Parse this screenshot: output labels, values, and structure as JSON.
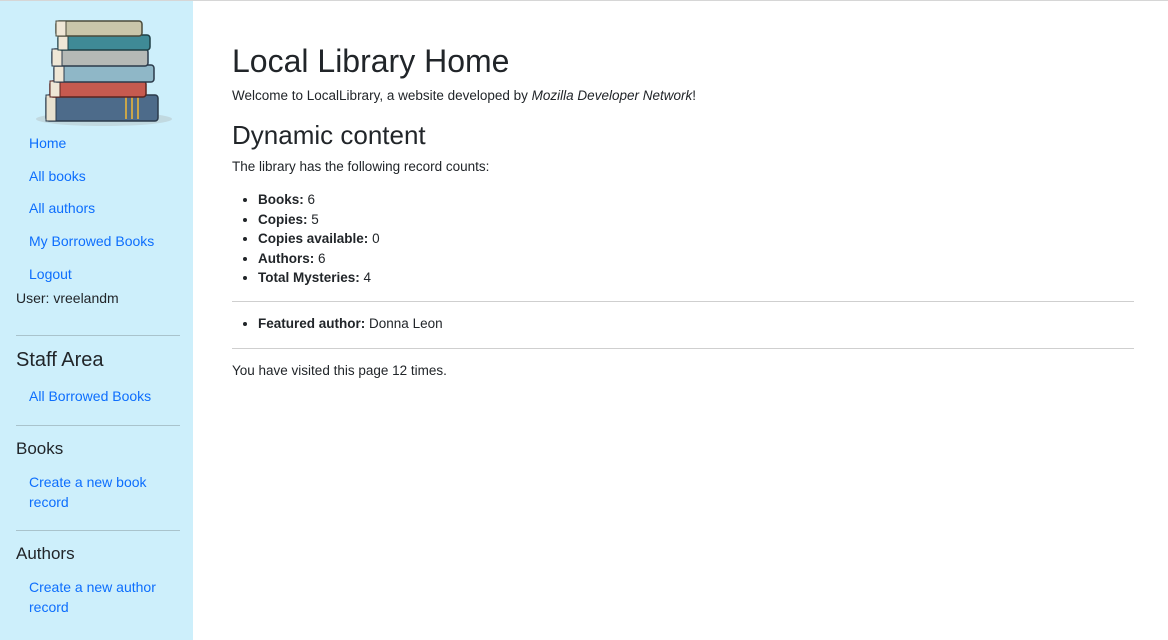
{
  "sidebar": {
    "nav": [
      {
        "label": "Home"
      },
      {
        "label": "All books"
      },
      {
        "label": "All authors"
      },
      {
        "label": "My Borrowed Books"
      },
      {
        "label": "Logout"
      }
    ],
    "user_text": "User: vreelandm",
    "staff_heading": "Staff Area",
    "staff_link": "All Borrowed Books",
    "books_heading": "Books",
    "books_link": "Create a new book record",
    "authors_heading": "Authors",
    "authors_link": "Create a new author record",
    "logo_icon": "stack-of-books-logo",
    "link_color": "#0d6efd",
    "background_color": "#cdeffb"
  },
  "main": {
    "title": "Local Library Home",
    "welcome_prefix": "Welcome to LocalLibrary, a website developed by ",
    "welcome_em": "Mozilla Developer Network",
    "welcome_suffix": "!",
    "dynamic_heading": "Dynamic content",
    "intro": "The library has the following record counts:",
    "counts": [
      {
        "label": "Books:",
        "value": "6"
      },
      {
        "label": "Copies:",
        "value": "5"
      },
      {
        "label": "Copies available:",
        "value": "0"
      },
      {
        "label": "Authors:",
        "value": "6"
      },
      {
        "label": "Total Mysteries:",
        "value": "4"
      }
    ],
    "featured_label": "Featured author:",
    "featured_value": "Donna Leon",
    "visits": "You have visited this page 12 times."
  }
}
